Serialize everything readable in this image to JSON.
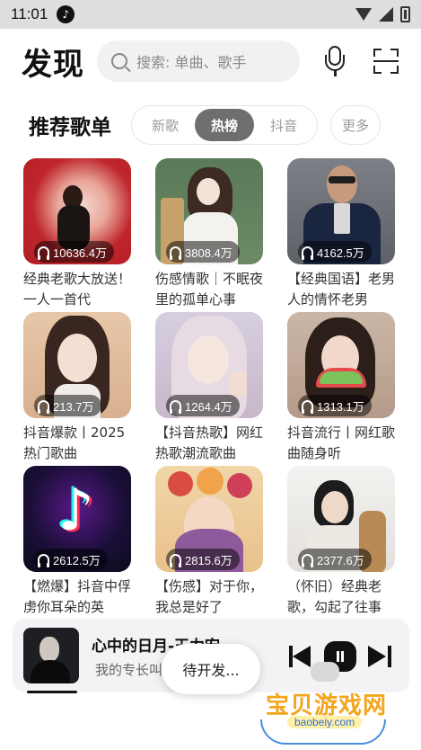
{
  "status_bar": {
    "time": "11:01"
  },
  "header": {
    "logo": "发现",
    "search_placeholder": "搜索: 单曲、歌手"
  },
  "section": {
    "title": "推荐歌单",
    "tabs": [
      {
        "label": "新歌",
        "active": false
      },
      {
        "label": "热榜",
        "active": true
      },
      {
        "label": "抖音",
        "active": false
      }
    ],
    "more_label": "更多"
  },
  "playlists": [
    {
      "plays": "10636.4万",
      "title": "经典老歌大放送！一人一首代"
    },
    {
      "plays": "3808.4万",
      "title": "伤感情歌｜不眠夜里的孤单心事"
    },
    {
      "plays": "4162.5万",
      "title": "【经典国语】老男人的情怀老男"
    },
    {
      "plays": "213.7万",
      "title": "抖音爆款丨2025热门歌曲"
    },
    {
      "plays": "1264.4万",
      "title": "【抖音热歌】网红热歌潮流歌曲"
    },
    {
      "plays": "1313.1万",
      "title": "抖音流行丨网红歌曲随身听"
    },
    {
      "plays": "2612.5万",
      "title": "【燃爆】抖音中俘虏你耳朵的英"
    },
    {
      "plays": "2815.6万",
      "title": "【伤感】对于你，我总是好了"
    },
    {
      "plays": "2377.6万",
      "title": "（怀旧）经典老歌，勾起了往事"
    }
  ],
  "player": {
    "song": "心中的日月-王力宏",
    "lyric": "我的专长叫"
  },
  "toast": "待开发...",
  "watermark": {
    "text": "宝贝游戏网",
    "url": "baobeiy.com"
  },
  "colors": {
    "active_tab": "#6e6e6e",
    "accent": "#111111",
    "background": "#ffffff"
  }
}
